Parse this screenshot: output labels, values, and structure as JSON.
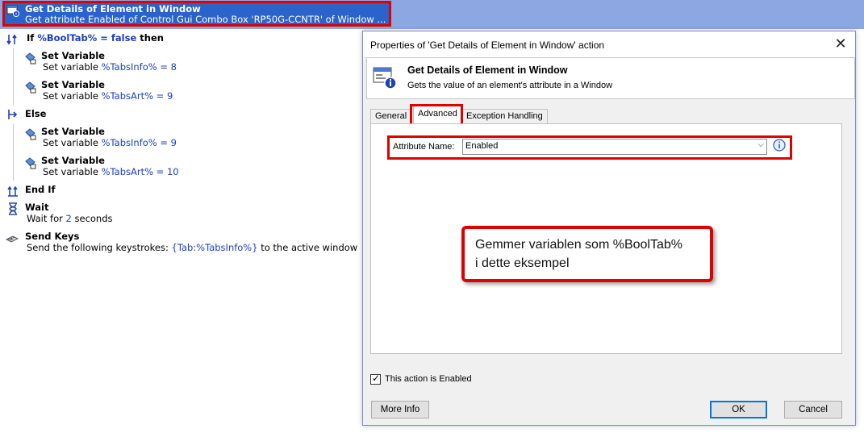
{
  "script": {
    "selected": {
      "title": "Get Details of Element in Window",
      "subtitle": "Get attribute Enabled of Control Gui Combo Box 'RP50G-CCNTR' of Window  ..."
    },
    "if_line": {
      "keyword": "If",
      "var": "%BoolTab%",
      "op": "= false",
      "then": "then"
    },
    "actions": [
      {
        "title": "Set Variable",
        "prefix": "Set variable",
        "var": "%TabsInfo%",
        "value": "= 8"
      },
      {
        "title": "Set Variable",
        "prefix": "Set variable",
        "var": "%TabsArt%",
        "value": "= 9"
      },
      {
        "title": "Set Variable",
        "prefix": "Set variable",
        "var": "%TabsInfo%",
        "value": "= 9"
      },
      {
        "title": "Set Variable",
        "prefix": "Set variable",
        "var": "%TabsArt%",
        "value": "= 10"
      }
    ],
    "else_label": "Else",
    "endif_label": "End If",
    "wait": {
      "title": "Wait",
      "prefix": "Wait for",
      "value": "2",
      "suffix": "seconds"
    },
    "send_keys": {
      "title": "Send Keys",
      "prefix": "Send the following keystrokes:",
      "keys": "{Tab:%TabsInfo%}",
      "suffix": "to the active window"
    }
  },
  "dialog": {
    "title": "Properties of 'Get Details of Element in Window' action",
    "header_title": "Get Details of Element in Window",
    "header_subtitle": "Gets the value of an element's attribute in a Window",
    "tabs": [
      "General",
      "Advanced",
      "Exception Handling"
    ],
    "attribute_label": "Attribute Name:",
    "attribute_value": "Enabled",
    "callout": "Gemmer variablen som %BoolTab%\ni dette eksempel",
    "enabled_checkbox": "This action is Enabled",
    "buttons": {
      "more_info": "More Info",
      "ok": "OK",
      "cancel": "Cancel"
    }
  },
  "colors": {
    "highlight": "#e00000",
    "selection": "#2a63c9",
    "variable": "#1a3fbf"
  }
}
